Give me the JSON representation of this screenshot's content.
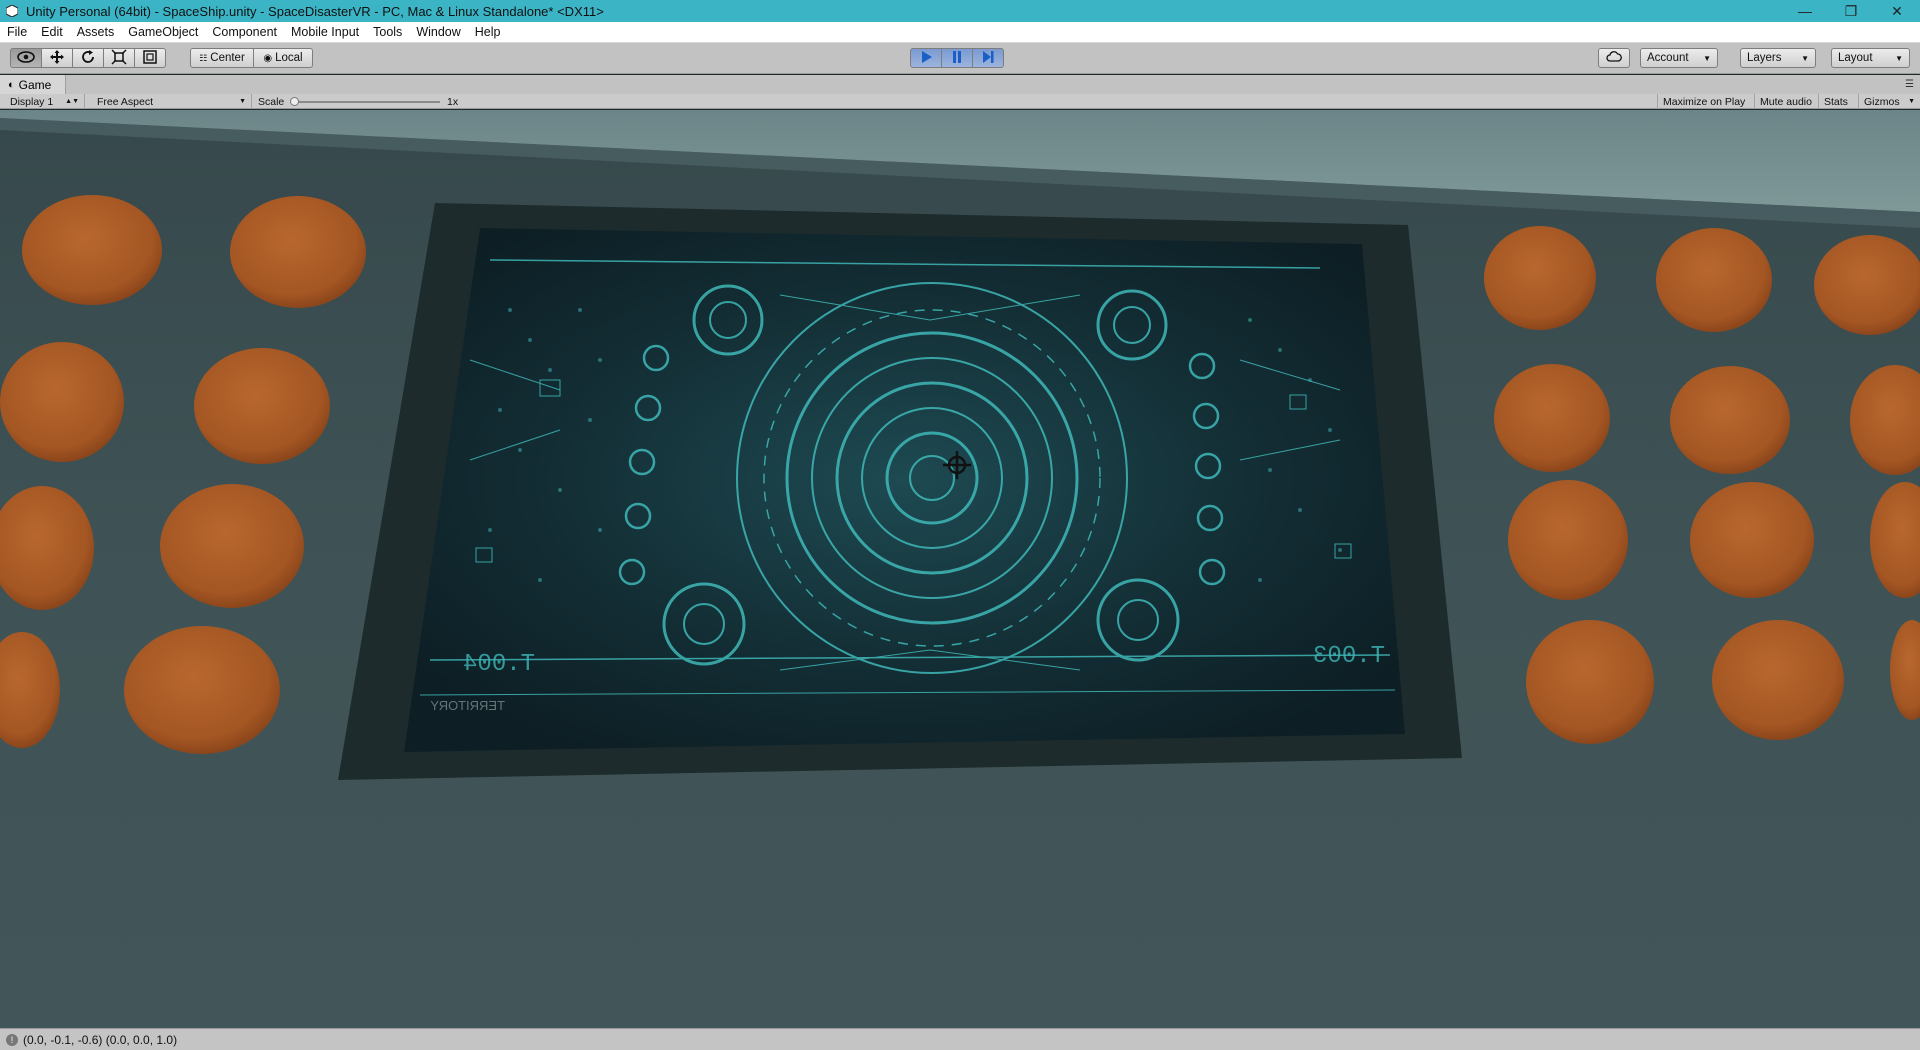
{
  "window": {
    "title": "Unity Personal (64bit) - SpaceShip.unity - SpaceDisasterVR - PC, Mac & Linux Standalone* <DX11>",
    "controls": [
      "minimize",
      "restore",
      "close"
    ]
  },
  "menu": [
    "File",
    "Edit",
    "Assets",
    "GameObject",
    "Component",
    "Mobile Input",
    "Tools",
    "Window",
    "Help"
  ],
  "toolbar": {
    "tools": [
      "hand-icon",
      "move-icon",
      "rotate-icon",
      "scale-icon",
      "rect-icon"
    ],
    "pivot_mode": "Center",
    "pivot_rotation": "Local",
    "account_label": "Account",
    "layers_label": "Layers",
    "layout_label": "Layout"
  },
  "game_tab": {
    "label": "Game"
  },
  "game_bar": {
    "display": "Display 1",
    "aspect": "Free Aspect",
    "scale_label": "Scale",
    "scale_value": "1x",
    "maximize": "Maximize on Play",
    "mute": "Mute audio",
    "stats": "Stats",
    "gizmos": "Gizmos"
  },
  "screen_labels": {
    "left_code": "T.004",
    "right_code": "T.003",
    "territory": "TERRITORY"
  },
  "status": "(0.0, -0.1, -0.6) (0.0, 0.0, 1.0)",
  "colors": {
    "titlebar": "#3bb4c6",
    "button_orange": "#a85a26",
    "hud_teal": "#3fb8b8",
    "wall": "#3a4a4d"
  }
}
